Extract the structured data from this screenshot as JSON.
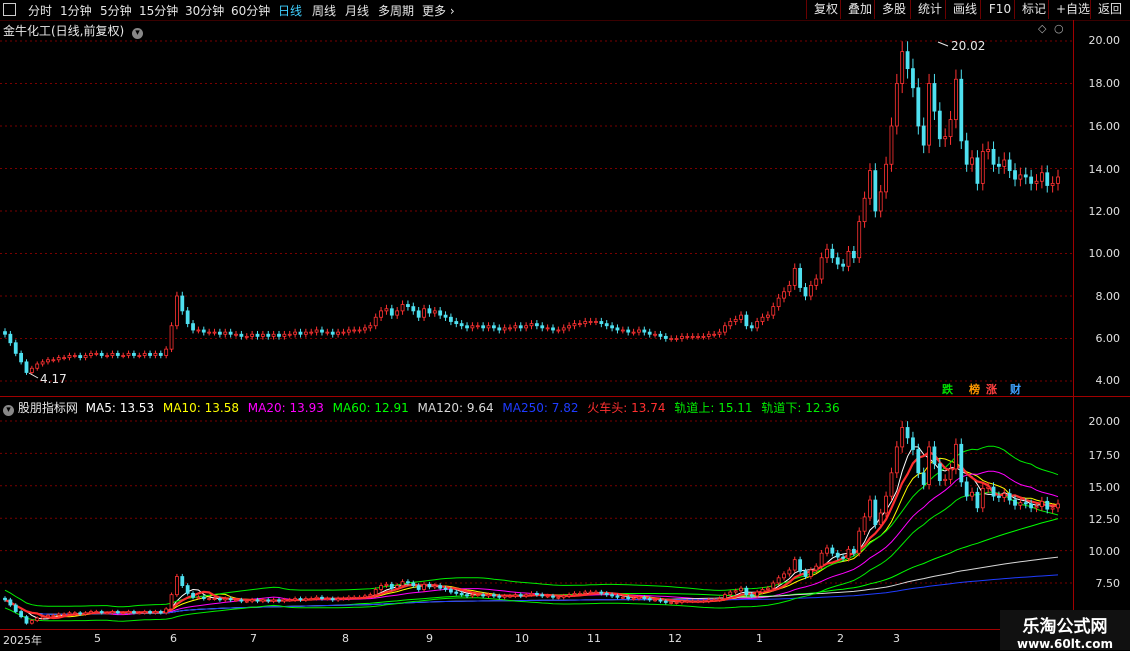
{
  "toolbar": {
    "periods": [
      "分时",
      "1分钟",
      "5分钟",
      "15分钟",
      "30分钟",
      "60分钟",
      "日线",
      "周线",
      "月线",
      "多周期",
      "更多"
    ],
    "active_period": "日线",
    "buttons": [
      "复权",
      "叠加",
      "多股",
      "统计",
      "画线",
      "F10",
      "标记",
      "+自选",
      "返回"
    ]
  },
  "main_chart": {
    "title": "金牛化工(日线,前复权)",
    "high_label": "20.02",
    "low_label": "4.17",
    "y_ticks": [
      "20.00",
      "18.00",
      "16.00",
      "14.00",
      "12.00",
      "10.00",
      "8.00",
      "6.00",
      "4.00"
    ],
    "badges": [
      {
        "text": "跌",
        "color": "#00e000"
      },
      {
        "text": "榜",
        "color": "#ff9900"
      },
      {
        "text": "涨",
        "color": "#ff4040"
      },
      {
        "text": "财",
        "color": "#3fa0ff"
      }
    ]
  },
  "indicator": {
    "name": "股朋指标网",
    "legend": [
      {
        "label": "MA5: 13.53",
        "color": "#ffffff"
      },
      {
        "label": "MA10: 13.58",
        "color": "#ffff00"
      },
      {
        "label": "MA20: 13.93",
        "color": "#ff00ff"
      },
      {
        "label": "MA60: 12.91",
        "color": "#00ff00"
      },
      {
        "label": "MA120: 9.64",
        "color": "#d8d8d8"
      },
      {
        "label": "MA250: 7.82",
        "color": "#1f3cff"
      },
      {
        "label": "火车头: 13.74",
        "color": "#ff3030"
      },
      {
        "label": "轨道上: 15.11",
        "color": "#00ee00"
      },
      {
        "label": "轨道下: 12.36",
        "color": "#00ee00"
      }
    ],
    "y_ticks": [
      "20.00",
      "17.50",
      "15.00",
      "12.50",
      "10.00",
      "7.50"
    ]
  },
  "x_axis": [
    "2025年",
    "5",
    "6",
    "7",
    "8",
    "9",
    "10",
    "11",
    "12",
    "1",
    "2",
    "3"
  ],
  "watermark": {
    "title": "乐淘公式网",
    "url": "www.60lt.com"
  },
  "chart_data": {
    "type": "candlestick",
    "price_min": 4.17,
    "price_max": 20.02,
    "close_series": [
      6.2,
      5.8,
      5.3,
      4.9,
      4.4,
      4.6,
      4.8,
      4.9,
      5.0,
      5.0,
      5.1,
      5.1,
      5.2,
      5.2,
      5.1,
      5.2,
      5.3,
      5.3,
      5.2,
      5.2,
      5.3,
      5.2,
      5.2,
      5.3,
      5.2,
      5.2,
      5.3,
      5.2,
      5.3,
      5.2,
      5.5,
      6.6,
      8.0,
      7.3,
      6.7,
      6.4,
      6.4,
      6.3,
      6.3,
      6.3,
      6.2,
      6.3,
      6.2,
      6.2,
      6.1,
      6.1,
      6.2,
      6.1,
      6.2,
      6.1,
      6.2,
      6.1,
      6.2,
      6.2,
      6.3,
      6.2,
      6.3,
      6.3,
      6.4,
      6.3,
      6.3,
      6.2,
      6.3,
      6.3,
      6.4,
      6.4,
      6.4,
      6.5,
      6.6,
      7.0,
      7.3,
      7.4,
      7.1,
      7.3,
      7.6,
      7.5,
      7.3,
      7.0,
      7.4,
      7.2,
      7.3,
      7.1,
      7.0,
      6.8,
      6.7,
      6.6,
      6.5,
      6.6,
      6.6,
      6.5,
      6.6,
      6.5,
      6.4,
      6.5,
      6.5,
      6.6,
      6.5,
      6.6,
      6.7,
      6.6,
      6.5,
      6.5,
      6.4,
      6.4,
      6.5,
      6.6,
      6.7,
      6.7,
      6.8,
      6.8,
      6.8,
      6.7,
      6.6,
      6.5,
      6.4,
      6.4,
      6.3,
      6.3,
      6.4,
      6.3,
      6.2,
      6.2,
      6.1,
      6.0,
      6.0,
      6.0,
      6.1,
      6.1,
      6.1,
      6.1,
      6.1,
      6.2,
      6.2,
      6.3,
      6.6,
      6.8,
      6.9,
      7.1,
      6.6,
      6.5,
      6.8,
      7.0,
      7.1,
      7.5,
      7.9,
      8.2,
      8.5,
      9.3,
      8.4,
      8.0,
      8.5,
      8.8,
      9.8,
      10.2,
      9.8,
      9.5,
      9.4,
      10.1,
      9.8,
      11.5,
      12.6,
      13.9,
      12.0,
      12.9,
      14.2,
      16.0,
      18.0,
      19.5,
      18.7,
      17.8,
      16.0,
      15.1,
      18.0,
      16.7,
      15.4,
      15.5,
      16.3,
      18.2,
      15.3,
      14.2,
      14.5,
      13.3,
      14.8,
      14.9,
      14.2,
      14.1,
      14.4,
      13.9,
      13.5,
      13.7,
      13.6,
      13.3,
      13.4,
      13.8,
      13.2,
      13.3,
      13.6
    ]
  }
}
